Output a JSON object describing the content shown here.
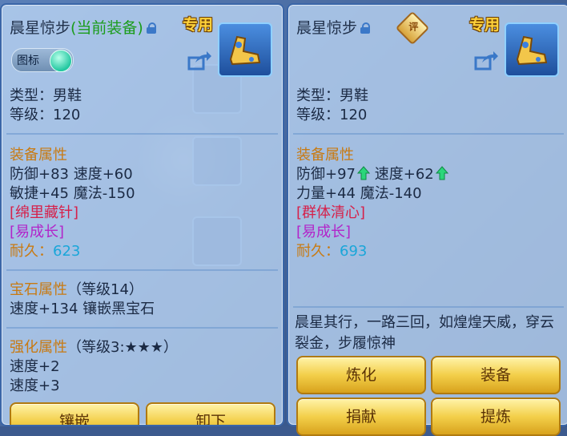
{
  "left_panel": {
    "title_name": "晨星惊步",
    "title_equipped": "(当前装备)",
    "exclusive": "专用",
    "toggle_label": "图标",
    "type": "类型：男鞋",
    "level": "等级：120",
    "equip_attr_heading": "装备属性",
    "attr_line1": "防御+83 速度+60",
    "attr_line2": "敏捷+45 魔法-150",
    "special_skill": "[绵里藏针]",
    "special_effect": "[易成长]",
    "durability_label": "耐久：",
    "durability_value": "623",
    "gem_heading": "宝石属性",
    "gem_level": "（等级14）",
    "gem_line": "速度+134 镶嵌黑宝石",
    "enhance_heading": "强化属性",
    "enhance_level": "（等级3:★★★）",
    "enhance_line1": "速度+2",
    "enhance_line2": "速度+3",
    "buttons": [
      "镶嵌",
      "卸下"
    ]
  },
  "right_panel": {
    "title_name": "晨星惊步",
    "review_badge": "评",
    "exclusive": "专用",
    "type": "类型：男鞋",
    "level": "等级：120",
    "equip_attr_heading": "装备属性",
    "attr_defense": "防御+97",
    "attr_speed": "速度+62",
    "attr_line2": "力量+44 魔法-140",
    "special_skill": "[群体清心]",
    "special_effect": "[易成长]",
    "durability_label": "耐久：",
    "durability_value": "693",
    "description": "晨星其行，一路三回，如煌煌天威，穿云裂金，步履惊神",
    "buttons": [
      "炼化",
      "装备",
      "捐献",
      "提炼"
    ]
  },
  "colors": {
    "gold_text": "#c87a12",
    "skill_red": "#d6204a",
    "effect_purple": "#b224c9",
    "durability_cyan": "#1aa6d9",
    "button_gold": "#f3cf4a",
    "up_arrow_green": "#2bd67b"
  },
  "icons": [
    "lock-icon",
    "share-icon",
    "boots-item-icon",
    "up-arrow-icon",
    "review-badge-icon"
  ]
}
